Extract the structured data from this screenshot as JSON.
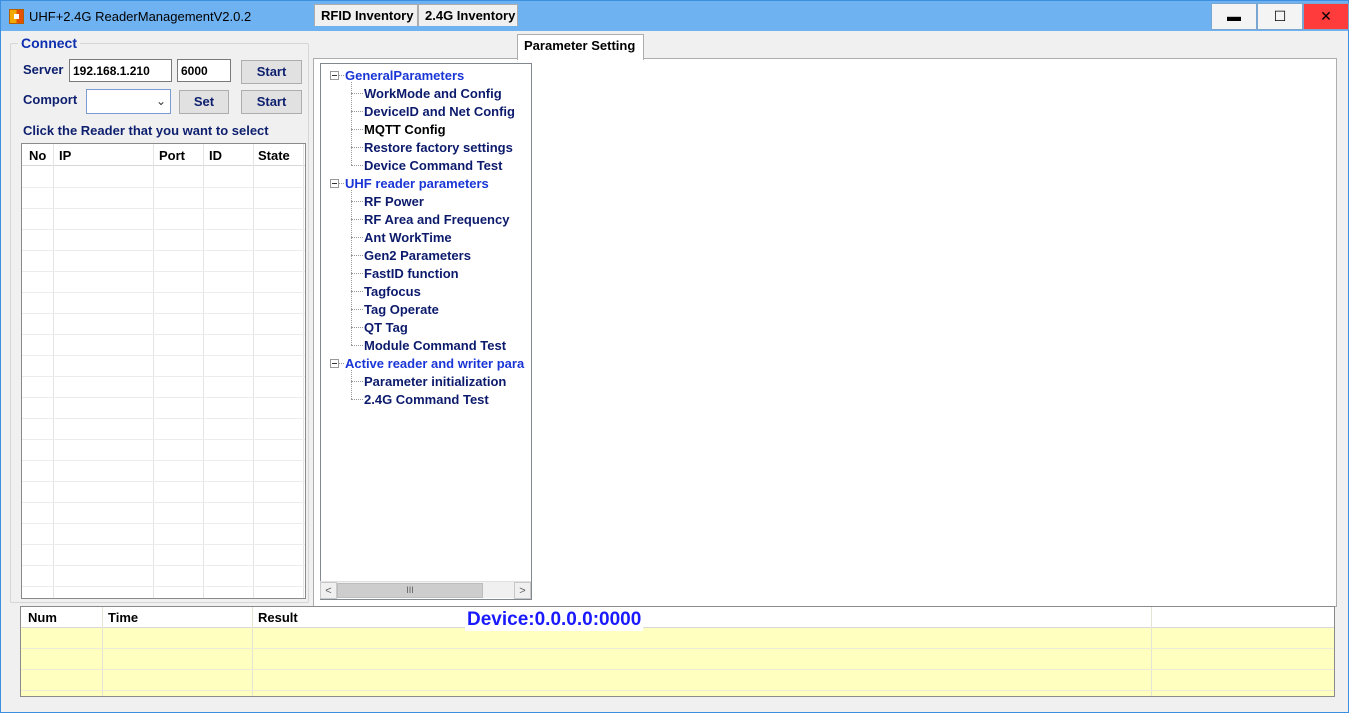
{
  "window": {
    "title": "UHF+2.4G ReaderManagementV2.0.2",
    "controls": {
      "minimize": "▬",
      "maximize": "☐",
      "close": "✕"
    }
  },
  "connect": {
    "group_title": "Connect",
    "server_label": "Server",
    "server_ip": "192.168.1.210",
    "server_port": "6000",
    "server_start": "Start",
    "comport_label": "Comport",
    "comport_value": "",
    "set_label": "Set",
    "comport_start": "Start",
    "instruction": "Click the Reader that you want to select"
  },
  "reader_table": {
    "columns": [
      "No",
      "IP",
      "Port",
      "ID",
      "State"
    ],
    "rows": []
  },
  "tabs": [
    {
      "label": "RFID Inventory",
      "active": false
    },
    {
      "label": "2.4G Inventory",
      "active": false
    },
    {
      "label": "Parameter Setting",
      "active": true
    }
  ],
  "tree": {
    "groups": [
      {
        "label": "GeneralParameters",
        "children": [
          "WorkMode and Config",
          "DeviceID and Net Config",
          "MQTT Config",
          "Restore factory settings",
          "Device Command Test"
        ]
      },
      {
        "label": "UHF reader parameters",
        "children": [
          "RF Power",
          "RF Area and Frequency",
          "Ant WorkTime",
          "Gen2 Parameters",
          "FastID function",
          "Tagfocus",
          "Tag Operate",
          "QT Tag",
          "Module Command Test"
        ]
      },
      {
        "label": "Active reader and writer para",
        "children": [
          "Parameter initialization",
          "2.4G Command Test"
        ]
      }
    ],
    "scroll_thumb": "III"
  },
  "log_table": {
    "columns": [
      "Num",
      "Time",
      "Result"
    ],
    "rows": []
  },
  "device_status": "Device:0.0.0.0:0000",
  "colors": {
    "titlebar": "#6fb2f2",
    "label_navy": "#0d1f6e",
    "tree_root": "#1a35d6",
    "device_text": "#1a1aff",
    "log_background": "#ffffc0",
    "close_button": "#ff3b3b"
  }
}
